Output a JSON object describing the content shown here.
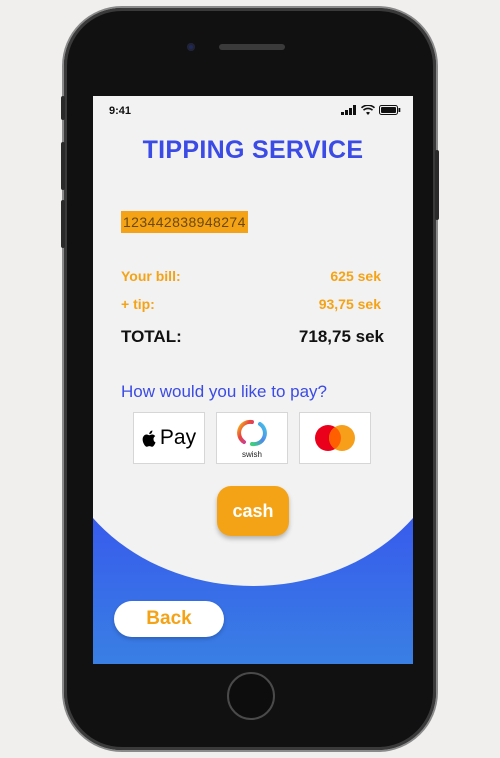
{
  "status_bar": {
    "time": "9:41"
  },
  "header": {
    "title": "TIPPING SERVICE"
  },
  "order": {
    "code": "123442838948274"
  },
  "bill": {
    "bill_label": "Your bill:",
    "bill_value": "625 sek",
    "tip_label": "+ tip:",
    "tip_value": "93,75 sek",
    "total_label": "TOTAL:",
    "total_value": "718,75 sek"
  },
  "payment": {
    "question": "How would you like to pay?",
    "apple_pay_label": "Pay",
    "swish_label": "swish",
    "cash_label": "cash"
  },
  "footer": {
    "back_label": "Back"
  },
  "colors": {
    "accent": "#f5a316",
    "brand_blue": "#3b4be6",
    "background": "#f2f2f2"
  }
}
